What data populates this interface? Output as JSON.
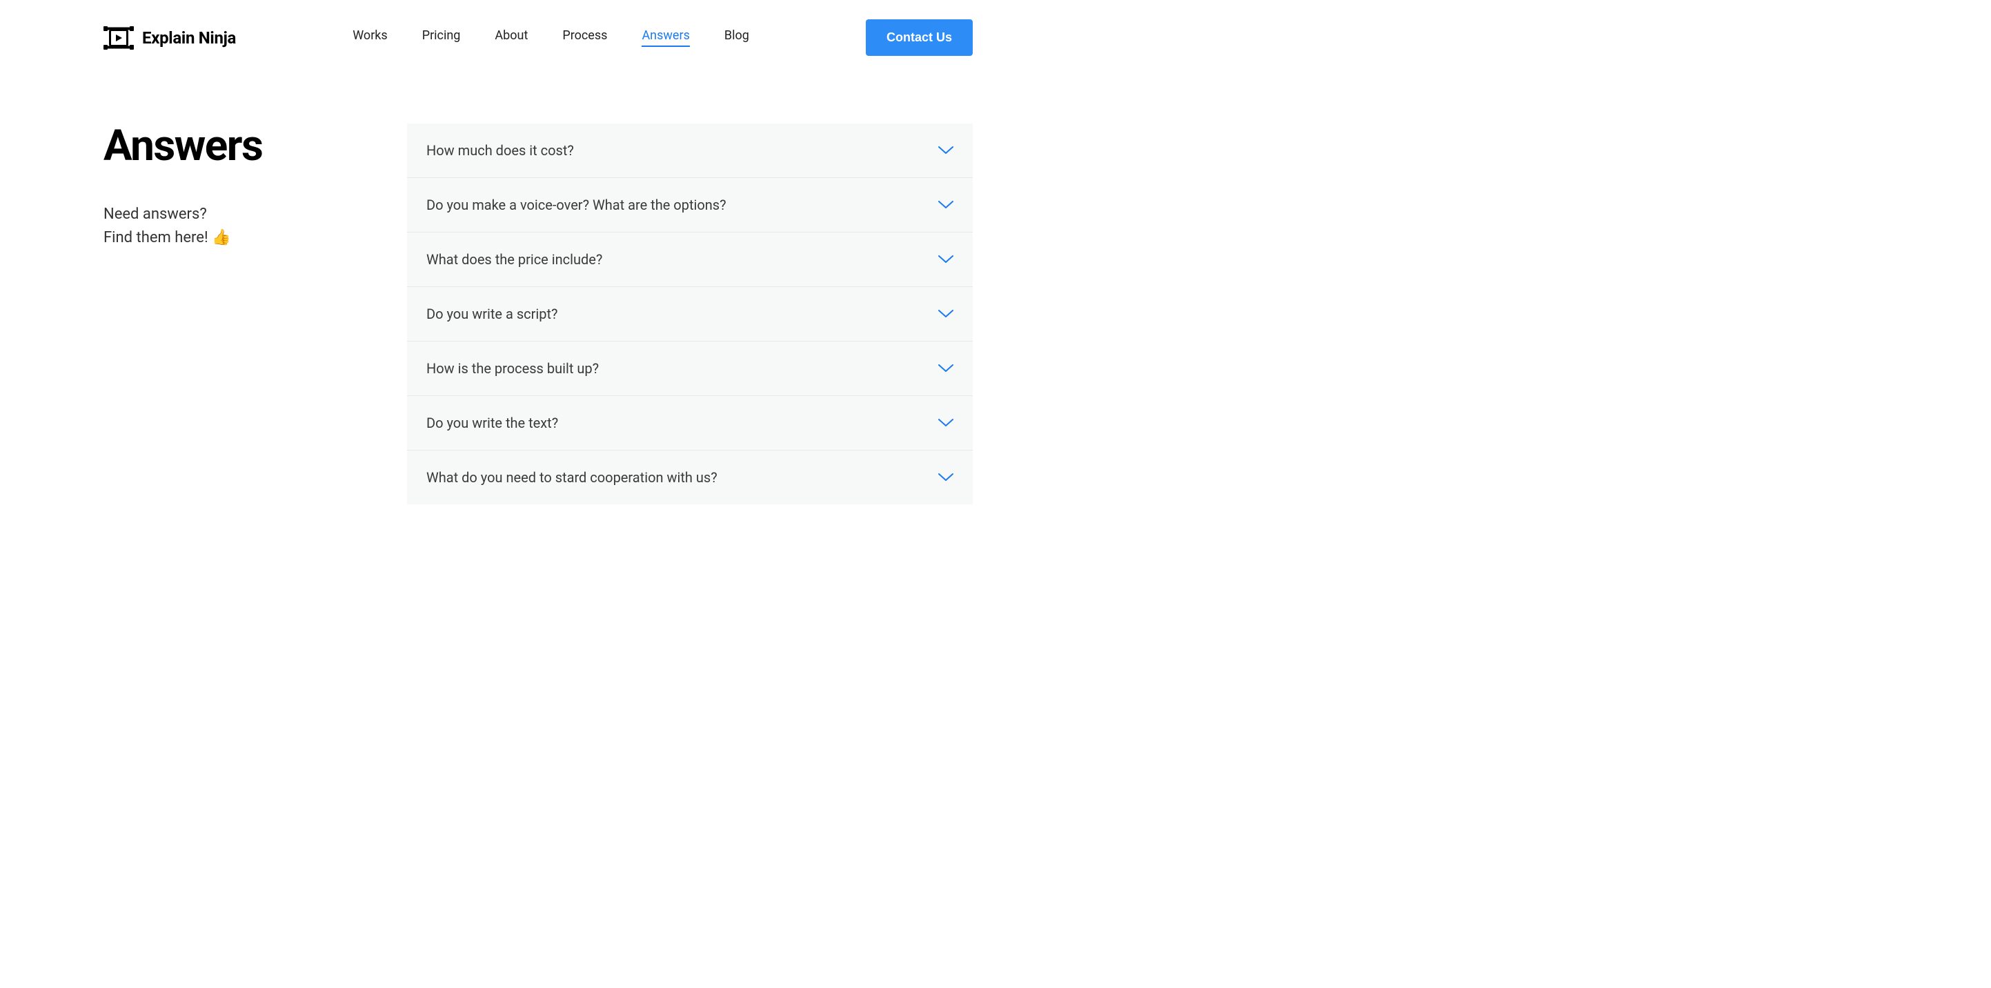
{
  "header": {
    "brand": "Explain Ninja",
    "nav": [
      {
        "label": "Works",
        "active": false
      },
      {
        "label": "Pricing",
        "active": false
      },
      {
        "label": "About",
        "active": false
      },
      {
        "label": "Process",
        "active": false
      },
      {
        "label": "Answers",
        "active": true
      },
      {
        "label": "Blog",
        "active": false
      }
    ],
    "contact_label": "Contact Us"
  },
  "intro": {
    "title": "Answers",
    "subtitle_line1": "Need answers?",
    "subtitle_line2": "Find them here! 👍"
  },
  "faq": [
    {
      "question": "How much does it cost?"
    },
    {
      "question": "Do you make a voice-over? What are the options?"
    },
    {
      "question": "What does the price include?"
    },
    {
      "question": "Do you write a script?"
    },
    {
      "question": "How is the process built up?"
    },
    {
      "question": "Do you write the text?"
    },
    {
      "question": "What do you need to stard cooperation with us?"
    }
  ],
  "colors": {
    "accent": "#2e8cf7",
    "faq_bg": "#f7f8f8"
  }
}
